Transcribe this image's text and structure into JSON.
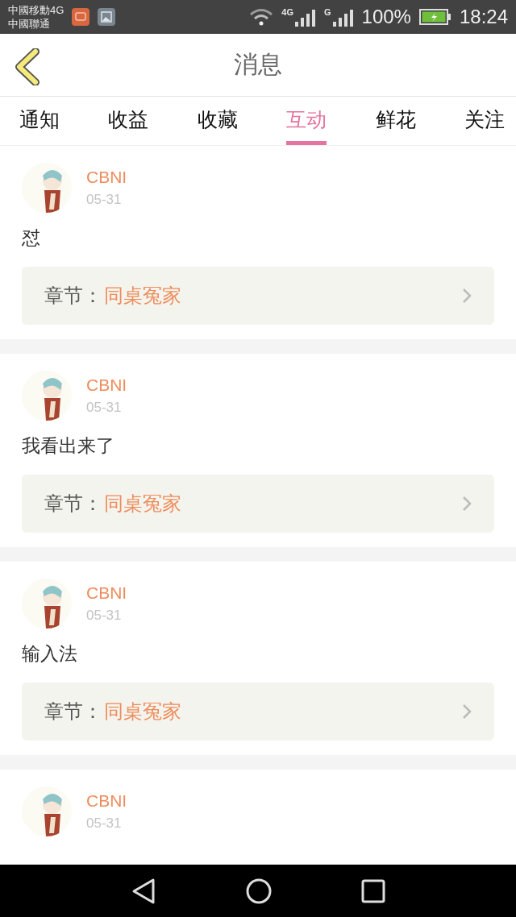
{
  "status_bar": {
    "carriers": [
      "中國移動4G",
      "中國聯通"
    ],
    "signal_labels": [
      "4G",
      "G"
    ],
    "battery": "100%",
    "time": "18:24"
  },
  "header": {
    "title": "消息"
  },
  "tabs": [
    {
      "label": "通知",
      "selected": false
    },
    {
      "label": "收益",
      "selected": false
    },
    {
      "label": "收藏",
      "selected": false
    },
    {
      "label": "互动",
      "selected": true
    },
    {
      "label": "鲜花",
      "selected": false
    },
    {
      "label": "关注",
      "selected": false
    }
  ],
  "messages": [
    {
      "user": "CBNI",
      "date": "05-31",
      "text": "怼",
      "chapter_label": "章节：",
      "chapter": "同桌冤家"
    },
    {
      "user": "CBNI",
      "date": "05-31",
      "text": "我看出来了",
      "chapter_label": "章节：",
      "chapter": "同桌冤家"
    },
    {
      "user": "CBNI",
      "date": "05-31",
      "text": "输入法",
      "chapter_label": "章节：",
      "chapter": "同桌冤家"
    },
    {
      "user": "CBNI",
      "date": "05-31"
    }
  ]
}
